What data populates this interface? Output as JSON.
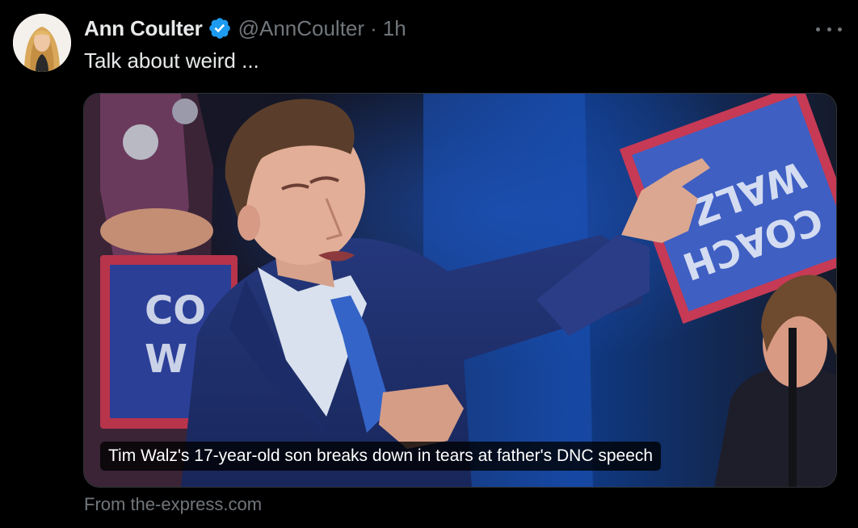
{
  "author": {
    "display_name": "Ann Coulter",
    "handle": "@AnnCoulter",
    "separator": "·",
    "timestamp": "1h",
    "verified": true,
    "avatar_icon": "avatar-blonde-woman"
  },
  "tweet": {
    "text": "Talk about weird ..."
  },
  "card": {
    "caption": "Tim Walz's 17-year-old son breaks down in tears at father's DNC speech",
    "source": "From the-express.com"
  },
  "icons": {
    "verified": "verified-badge-icon",
    "more": "more-options-icon"
  },
  "colors": {
    "background": "#000000",
    "primary_text": "#e7e9ea",
    "secondary_text": "#71767b",
    "verified_blue": "#1d9bf0",
    "border": "#2f3336"
  }
}
